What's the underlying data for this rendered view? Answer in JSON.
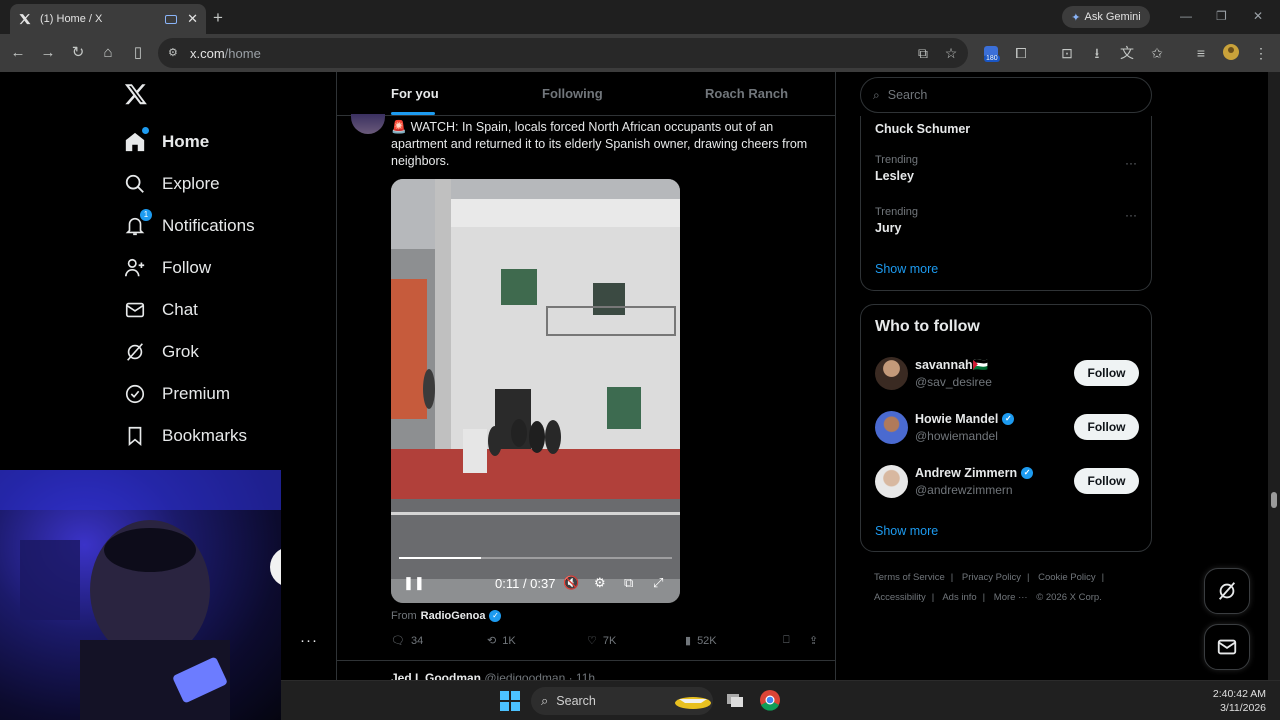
{
  "browser": {
    "tab_title": "(1) Home / X",
    "tab_favicon": "X",
    "new_tab_icon": "+",
    "gemini_label": "Ask Gemini",
    "url_host": "x.com",
    "url_path": "/home",
    "extension_badge": "180",
    "window_controls": [
      "—",
      "❐",
      "✕"
    ]
  },
  "nav": {
    "items": [
      {
        "label": "Home",
        "icon": "home-icon"
      },
      {
        "label": "Explore",
        "icon": "search-icon"
      },
      {
        "label": "Notifications",
        "icon": "bell-icon",
        "badge": "1"
      },
      {
        "label": "Follow",
        "icon": "add-user-icon"
      },
      {
        "label": "Chat",
        "icon": "mail-icon"
      },
      {
        "label": "Grok",
        "icon": "grok-icon"
      },
      {
        "label": "Premium",
        "icon": "verified-icon"
      },
      {
        "label": "Bookmarks",
        "icon": "bookmark-icon"
      }
    ],
    "more": "···"
  },
  "feed": {
    "tabs": [
      "For you",
      "Following",
      "Roach Ranch"
    ],
    "tweet": {
      "text": "WATCH: In Spain, locals forced North African occupants out of an apartment and returned it to its elderly Spanish owner, drawing cheers from neighbors.",
      "video_time": "0:11 / 0:37",
      "video_progress": 0.3,
      "from_label": "From",
      "from_account": "RadioGenoa",
      "replies": "34",
      "reposts": "1K",
      "likes": "7K",
      "views": "52K"
    },
    "next_tweet": {
      "name": "Jed I. Goodman",
      "handle": "@jedigoodman · 11h"
    }
  },
  "right": {
    "search_placeholder": "Search",
    "trends": [
      {
        "category": "",
        "name": "Chuck Schumer"
      },
      {
        "category": "Trending",
        "name": "Lesley"
      },
      {
        "category": "Trending",
        "name": "Jury"
      }
    ],
    "trends_show_more": "Show more",
    "who_to_follow_title": "Who to follow",
    "follow_suggestions": [
      {
        "name": "savannah🇵🇸",
        "handle": "@sav_desiree",
        "verified": false,
        "button": "Follow"
      },
      {
        "name": "Howie Mandel",
        "handle": "@howiemandel",
        "verified": true,
        "button": "Follow"
      },
      {
        "name": "Andrew Zimmern",
        "handle": "@andrewzimmern",
        "verified": true,
        "button": "Follow"
      }
    ],
    "wtf_show_more": "Show more",
    "footer_links": [
      "Terms of Service",
      "|",
      "Privacy Policy",
      "|",
      "Cookie Policy",
      "|",
      "Accessibility",
      "|",
      "Ads info",
      "|",
      "More ···",
      "© 2026 X Corp."
    ]
  },
  "taskbar": {
    "search_label": "Search",
    "time": "2:40:42 AM",
    "date": "3/11/2026"
  },
  "colors": {
    "accent": "#1d9bf0",
    "background": "#000000",
    "border": "#2f3336"
  }
}
